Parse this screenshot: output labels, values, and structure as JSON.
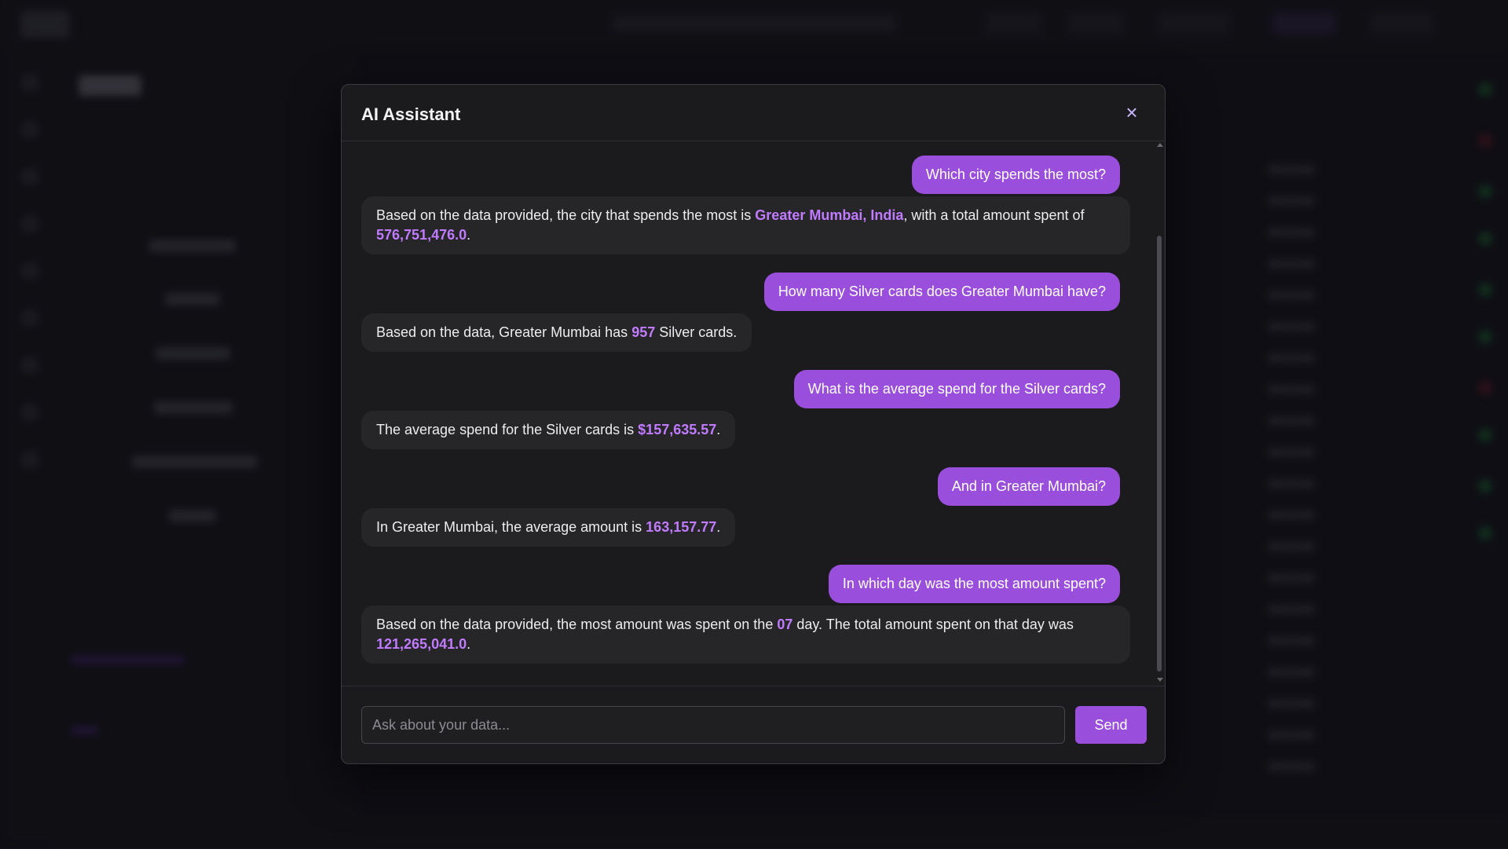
{
  "modal": {
    "title": "AI Assistant",
    "close_glyph": "×"
  },
  "messages": [
    {
      "role": "user",
      "text": "Which city spends the most?"
    },
    {
      "role": "assistant",
      "parts": [
        {
          "t": "Based on the data provided, the city that spends the most is "
        },
        {
          "t": "Greater Mumbai, India",
          "hl": true
        },
        {
          "t": ", with a total amount spent of "
        },
        {
          "t": "576,751,476.0",
          "hl": true
        },
        {
          "t": "."
        }
      ]
    },
    {
      "role": "user",
      "text": "How many Silver cards does Greater Mumbai have?"
    },
    {
      "role": "assistant",
      "parts": [
        {
          "t": "Based on the data, Greater Mumbai has "
        },
        {
          "t": "957",
          "hl": true
        },
        {
          "t": " Silver cards."
        }
      ]
    },
    {
      "role": "user",
      "text": "What is the average spend for the Silver cards?"
    },
    {
      "role": "assistant",
      "parts": [
        {
          "t": "The average spend for the Silver cards is "
        },
        {
          "t": "$157,635.57",
          "hl": true
        },
        {
          "t": "."
        }
      ]
    },
    {
      "role": "user",
      "text": "And in Greater Mumbai?"
    },
    {
      "role": "assistant",
      "parts": [
        {
          "t": "In Greater Mumbai, the average amount is "
        },
        {
          "t": "163,157.77",
          "hl": true
        },
        {
          "t": "."
        }
      ]
    },
    {
      "role": "user",
      "text": "In which day was the most amount spent?"
    },
    {
      "role": "assistant",
      "parts": [
        {
          "t": "Based on the data provided, the most amount was spent on the "
        },
        {
          "t": "07",
          "hl": true
        },
        {
          "t": " day. The total amount spent on that day was "
        },
        {
          "t": "121,265,041.0",
          "hl": true
        },
        {
          "t": "."
        }
      ]
    }
  ],
  "input": {
    "placeholder": "Ask about your data...",
    "value": ""
  },
  "send_label": "Send",
  "colors": {
    "accent": "#9a4fdc",
    "highlight": "#c07bff",
    "modal_bg": "#1b1b1d",
    "bubble_ai": "#262628"
  }
}
